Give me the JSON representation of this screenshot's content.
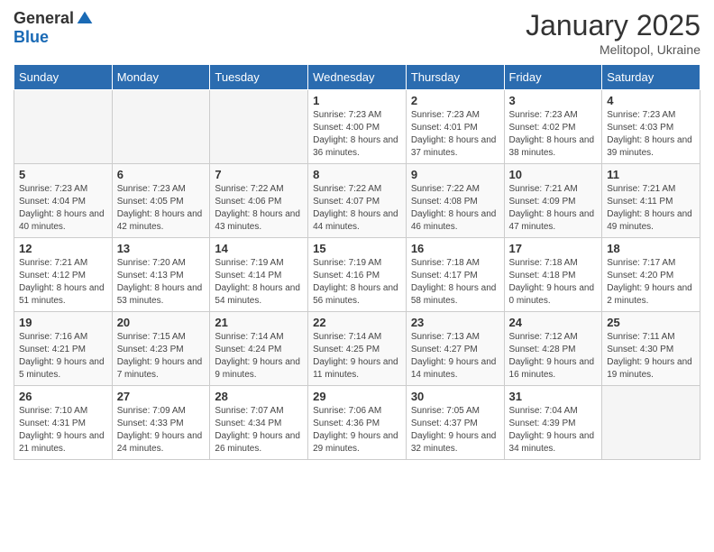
{
  "logo": {
    "general": "General",
    "blue": "Blue"
  },
  "title": "January 2025",
  "location": "Melitopol, Ukraine",
  "days_header": [
    "Sunday",
    "Monday",
    "Tuesday",
    "Wednesday",
    "Thursday",
    "Friday",
    "Saturday"
  ],
  "weeks": [
    [
      {
        "day": "",
        "info": ""
      },
      {
        "day": "",
        "info": ""
      },
      {
        "day": "",
        "info": ""
      },
      {
        "day": "1",
        "info": "Sunrise: 7:23 AM\nSunset: 4:00 PM\nDaylight: 8 hours and 36 minutes."
      },
      {
        "day": "2",
        "info": "Sunrise: 7:23 AM\nSunset: 4:01 PM\nDaylight: 8 hours and 37 minutes."
      },
      {
        "day": "3",
        "info": "Sunrise: 7:23 AM\nSunset: 4:02 PM\nDaylight: 8 hours and 38 minutes."
      },
      {
        "day": "4",
        "info": "Sunrise: 7:23 AM\nSunset: 4:03 PM\nDaylight: 8 hours and 39 minutes."
      }
    ],
    [
      {
        "day": "5",
        "info": "Sunrise: 7:23 AM\nSunset: 4:04 PM\nDaylight: 8 hours and 40 minutes."
      },
      {
        "day": "6",
        "info": "Sunrise: 7:23 AM\nSunset: 4:05 PM\nDaylight: 8 hours and 42 minutes."
      },
      {
        "day": "7",
        "info": "Sunrise: 7:22 AM\nSunset: 4:06 PM\nDaylight: 8 hours and 43 minutes."
      },
      {
        "day": "8",
        "info": "Sunrise: 7:22 AM\nSunset: 4:07 PM\nDaylight: 8 hours and 44 minutes."
      },
      {
        "day": "9",
        "info": "Sunrise: 7:22 AM\nSunset: 4:08 PM\nDaylight: 8 hours and 46 minutes."
      },
      {
        "day": "10",
        "info": "Sunrise: 7:21 AM\nSunset: 4:09 PM\nDaylight: 8 hours and 47 minutes."
      },
      {
        "day": "11",
        "info": "Sunrise: 7:21 AM\nSunset: 4:11 PM\nDaylight: 8 hours and 49 minutes."
      }
    ],
    [
      {
        "day": "12",
        "info": "Sunrise: 7:21 AM\nSunset: 4:12 PM\nDaylight: 8 hours and 51 minutes."
      },
      {
        "day": "13",
        "info": "Sunrise: 7:20 AM\nSunset: 4:13 PM\nDaylight: 8 hours and 53 minutes."
      },
      {
        "day": "14",
        "info": "Sunrise: 7:19 AM\nSunset: 4:14 PM\nDaylight: 8 hours and 54 minutes."
      },
      {
        "day": "15",
        "info": "Sunrise: 7:19 AM\nSunset: 4:16 PM\nDaylight: 8 hours and 56 minutes."
      },
      {
        "day": "16",
        "info": "Sunrise: 7:18 AM\nSunset: 4:17 PM\nDaylight: 8 hours and 58 minutes."
      },
      {
        "day": "17",
        "info": "Sunrise: 7:18 AM\nSunset: 4:18 PM\nDaylight: 9 hours and 0 minutes."
      },
      {
        "day": "18",
        "info": "Sunrise: 7:17 AM\nSunset: 4:20 PM\nDaylight: 9 hours and 2 minutes."
      }
    ],
    [
      {
        "day": "19",
        "info": "Sunrise: 7:16 AM\nSunset: 4:21 PM\nDaylight: 9 hours and 5 minutes."
      },
      {
        "day": "20",
        "info": "Sunrise: 7:15 AM\nSunset: 4:23 PM\nDaylight: 9 hours and 7 minutes."
      },
      {
        "day": "21",
        "info": "Sunrise: 7:14 AM\nSunset: 4:24 PM\nDaylight: 9 hours and 9 minutes."
      },
      {
        "day": "22",
        "info": "Sunrise: 7:14 AM\nSunset: 4:25 PM\nDaylight: 9 hours and 11 minutes."
      },
      {
        "day": "23",
        "info": "Sunrise: 7:13 AM\nSunset: 4:27 PM\nDaylight: 9 hours and 14 minutes."
      },
      {
        "day": "24",
        "info": "Sunrise: 7:12 AM\nSunset: 4:28 PM\nDaylight: 9 hours and 16 minutes."
      },
      {
        "day": "25",
        "info": "Sunrise: 7:11 AM\nSunset: 4:30 PM\nDaylight: 9 hours and 19 minutes."
      }
    ],
    [
      {
        "day": "26",
        "info": "Sunrise: 7:10 AM\nSunset: 4:31 PM\nDaylight: 9 hours and 21 minutes."
      },
      {
        "day": "27",
        "info": "Sunrise: 7:09 AM\nSunset: 4:33 PM\nDaylight: 9 hours and 24 minutes."
      },
      {
        "day": "28",
        "info": "Sunrise: 7:07 AM\nSunset: 4:34 PM\nDaylight: 9 hours and 26 minutes."
      },
      {
        "day": "29",
        "info": "Sunrise: 7:06 AM\nSunset: 4:36 PM\nDaylight: 9 hours and 29 minutes."
      },
      {
        "day": "30",
        "info": "Sunrise: 7:05 AM\nSunset: 4:37 PM\nDaylight: 9 hours and 32 minutes."
      },
      {
        "day": "31",
        "info": "Sunrise: 7:04 AM\nSunset: 4:39 PM\nDaylight: 9 hours and 34 minutes."
      },
      {
        "day": "",
        "info": ""
      }
    ]
  ]
}
